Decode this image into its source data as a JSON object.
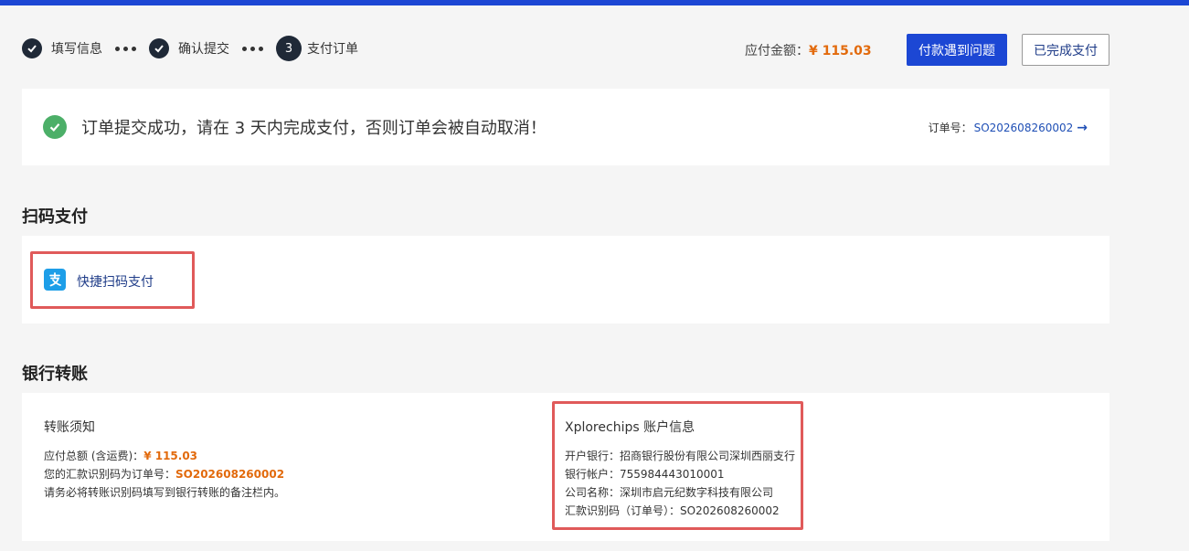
{
  "steps": [
    {
      "label": "填写信息",
      "state": "done"
    },
    {
      "label": "确认提交",
      "state": "done"
    },
    {
      "label": "支付订单",
      "number": "3",
      "state": "current"
    }
  ],
  "payment": {
    "amount_label": "应付金额：",
    "amount_value": "¥ 115.03",
    "problem_button": "付款遇到问题",
    "done_button": "已完成支付"
  },
  "success": {
    "message": "订单提交成功，请在 3 天内完成支付，否则订单会被自动取消！",
    "order_label": "订单号：",
    "order_number": "SO202608260002"
  },
  "qr_section": {
    "title": "扫码支付",
    "option_label": "快捷扫码支付",
    "icon": "alipay-icon"
  },
  "bank_section": {
    "title": "银行转账",
    "notice_title": "转账须知",
    "total_label": "应付总额 (含运费)：",
    "total_value": "¥ 115.03",
    "code_label": "您的汇款识别码为订单号：",
    "code_value": "SO202608260002",
    "note": "请务必将转账识别码填写到银行转账的备注栏内。",
    "account_title": "Xplorechips 账户信息",
    "account_lines": [
      "开户银行：招商银行股份有限公司深圳西丽支行",
      "银行帐户：755984443010001",
      "公司名称：深圳市启元纪数字科技有限公司",
      "汇款识别码（订单号）：SO202608260002"
    ]
  },
  "colors": {
    "brand_blue": "#1c47d4",
    "accent_orange": "#e26a0c",
    "success_green": "#4caf68",
    "highlight_red": "#e05a5a"
  }
}
